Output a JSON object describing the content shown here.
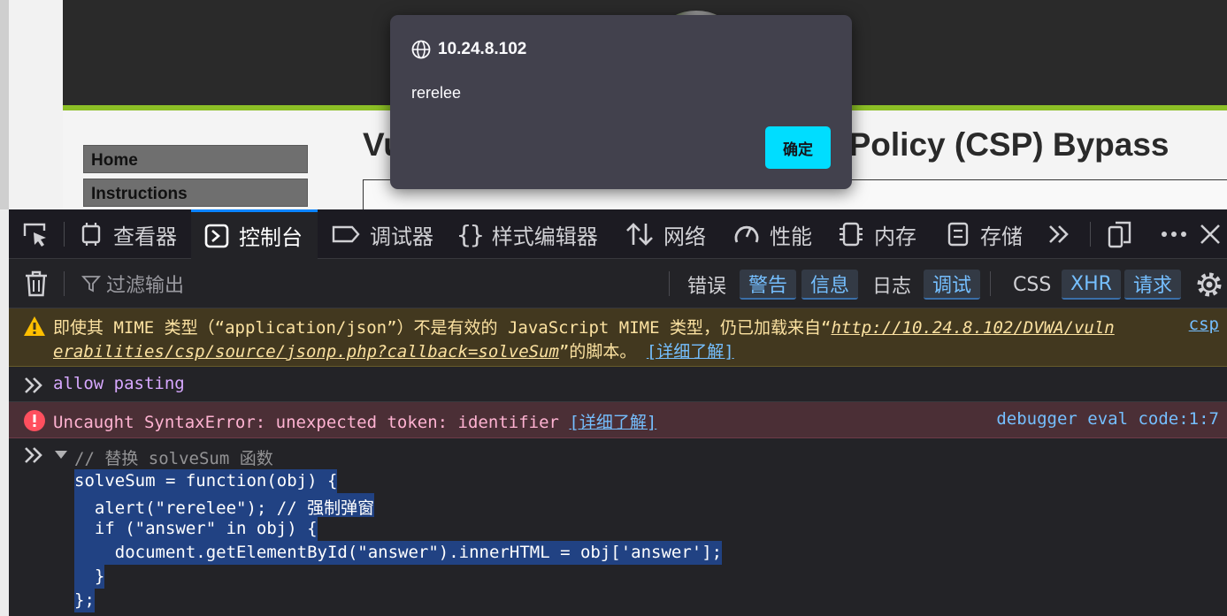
{
  "webpage": {
    "menu": [
      "Home",
      "Instructions"
    ],
    "heading": "Vulnerability: Content Security Policy (CSP) Bypass"
  },
  "alert": {
    "origin": "10.24.8.102",
    "message": "rerelee",
    "ok_label": "确定"
  },
  "devtools": {
    "tabs": [
      {
        "label": "查看器",
        "icon": "inspector-icon"
      },
      {
        "label": "控制台",
        "icon": "console-icon",
        "active": true
      },
      {
        "label": "调试器",
        "icon": "debugger-icon"
      },
      {
        "label": "样式编辑器",
        "icon": "style-editor-icon"
      },
      {
        "label": "网络",
        "icon": "network-icon"
      },
      {
        "label": "性能",
        "icon": "performance-icon"
      },
      {
        "label": "内存",
        "icon": "memory-icon"
      },
      {
        "label": "存储",
        "icon": "storage-icon"
      }
    ],
    "filter_placeholder": "过滤输出",
    "levels": [
      {
        "label": "错误",
        "on": false
      },
      {
        "label": "警告",
        "on": true
      },
      {
        "label": "信息",
        "on": true
      },
      {
        "label": "日志",
        "on": false
      },
      {
        "label": "调试",
        "on": true
      },
      {
        "label": "CSS",
        "on": false
      },
      {
        "label": "XHR",
        "on": true
      },
      {
        "label": "请求",
        "on": true
      }
    ]
  },
  "console": {
    "warning": {
      "prefix": "即使其 MIME 类型（“application/json”）不是有效的 JavaScript MIME 类型，仍已加载来自“",
      "url_part1": "http://10.24.8.102/DVWA/vuln",
      "url_part2": "erabilities/csp/source/jsonp.php?callback=solveSum",
      "suffix": "”的脚本。",
      "learn_more": "[详细了解]",
      "source": "csp"
    },
    "input1": "allow pasting",
    "error": {
      "text": "Uncaught SyntaxError: unexpected token: identifier",
      "learn_more": "[详细了解]",
      "source": "debugger eval code:1:7"
    },
    "input2": {
      "comment": "// 替换 solveSum 函数",
      "lines": [
        "solveSum = function(obj) {",
        "  alert(\"rerelee\"); // 强制弹窗",
        "  if (\"answer\" in obj) {",
        "    document.getElementById(\"answer\").innerHTML = obj['answer'];",
        "  }",
        "};"
      ]
    }
  },
  "colors": {
    "accent": "#0a84ff",
    "alert_button": "#00ddff",
    "warning_bg": "#42381f",
    "error_bg": "#4b2f36",
    "selection": "#214283"
  }
}
